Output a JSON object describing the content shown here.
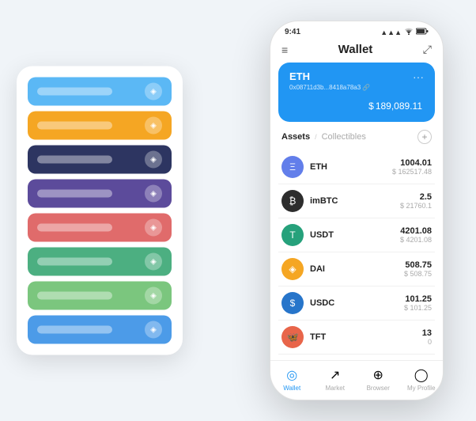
{
  "scene": {
    "background": "#f0f4f8"
  },
  "cardStack": {
    "cards": [
      {
        "color": "#5BB8F5",
        "iconText": "◈"
      },
      {
        "color": "#F5A623",
        "iconText": "◈"
      },
      {
        "color": "#2D3561",
        "iconText": "◈"
      },
      {
        "color": "#5C4B9B",
        "iconText": "◈"
      },
      {
        "color": "#E06B6B",
        "iconText": "◈"
      },
      {
        "color": "#4CAF81",
        "iconText": "◈"
      },
      {
        "color": "#7BC67E",
        "iconText": "◈"
      },
      {
        "color": "#4C9BE8",
        "iconText": "◈"
      }
    ]
  },
  "phone": {
    "statusBar": {
      "time": "9:41",
      "signal": "▲▲▲",
      "wifi": "wifi",
      "battery": "🔋"
    },
    "header": {
      "menuIcon": "≡",
      "title": "Wallet",
      "expandIcon": "⤢"
    },
    "ethCard": {
      "title": "ETH",
      "address": "0x08711d3b...8418a78a3 🔗",
      "currencySymbol": "$",
      "balance": "189,089.11",
      "dotsMenu": "···"
    },
    "assets": {
      "activeTab": "Assets",
      "divider": "/",
      "inactiveTab": "Collectibles",
      "addLabel": "+"
    },
    "assetList": [
      {
        "name": "ETH",
        "coinClass": "eth-coin",
        "coinSymbol": "Ξ",
        "amount": "1004.01",
        "usdValue": "$ 162517.48"
      },
      {
        "name": "imBTC",
        "coinClass": "imbtc-coin",
        "coinSymbol": "₿",
        "amount": "2.5",
        "usdValue": "$ 21760.1"
      },
      {
        "name": "USDT",
        "coinClass": "usdt-coin",
        "coinSymbol": "T",
        "amount": "4201.08",
        "usdValue": "$ 4201.08"
      },
      {
        "name": "DAI",
        "coinClass": "dai-coin",
        "coinSymbol": "◈",
        "amount": "508.75",
        "usdValue": "$ 508.75"
      },
      {
        "name": "USDC",
        "coinClass": "usdc-coin",
        "coinSymbol": "$",
        "amount": "101.25",
        "usdValue": "$ 101.25"
      },
      {
        "name": "TFT",
        "coinClass": "tft-coin",
        "coinSymbol": "🦋",
        "amount": "13",
        "usdValue": "0"
      }
    ],
    "bottomNav": [
      {
        "icon": "◎",
        "label": "Wallet",
        "active": true
      },
      {
        "icon": "↗",
        "label": "Market",
        "active": false
      },
      {
        "icon": "⊕",
        "label": "Browser",
        "active": false
      },
      {
        "icon": "◯",
        "label": "My Profile",
        "active": false
      }
    ]
  }
}
